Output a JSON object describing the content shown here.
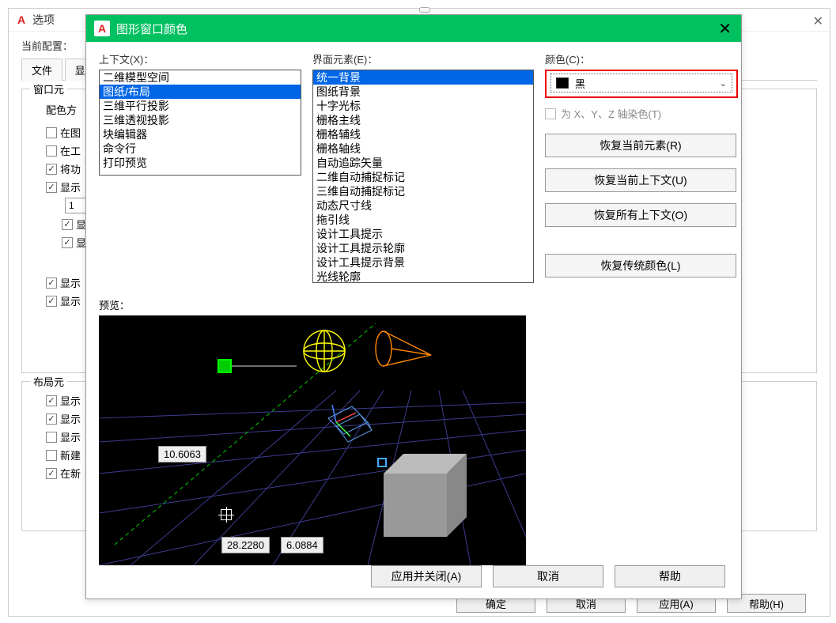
{
  "bg": {
    "title": "选项",
    "config_label": "当前配置：",
    "tabs": [
      "文件",
      "显"
    ],
    "fieldset1_title": "窗口元",
    "color_scheme_label": "配色方",
    "checks": [
      {
        "label": "在图",
        "checked": false
      },
      {
        "label": "在工",
        "checked": false
      },
      {
        "label": "将功",
        "checked": true
      },
      {
        "label": "显示",
        "checked": true
      }
    ],
    "spinner_value": "1",
    "nested_checks": [
      {
        "label": "显示",
        "checked": true
      },
      {
        "label": "显示",
        "checked": true
      }
    ],
    "fieldset2_title": "布局元",
    "checks2": [
      {
        "label": "显示",
        "checked": true
      },
      {
        "label": "显示",
        "checked": true
      },
      {
        "label": "显示",
        "checked": false
      },
      {
        "label": "新建",
        "checked": false
      },
      {
        "label": "在新",
        "checked": true
      }
    ],
    "buttons": [
      "确定",
      "取消",
      "应用(A)",
      "帮助(H)"
    ]
  },
  "fg": {
    "title": "图形窗口颜色",
    "context_label": "上下文(X)：",
    "context_items": [
      "二维模型空间",
      "图纸/布局",
      "三维平行投影",
      "三维透视投影",
      "块编辑器",
      "命令行",
      "打印预览"
    ],
    "context_selected_index": 1,
    "element_label": "界面元素(E)：",
    "element_items": [
      "统一背景",
      "图纸背景",
      "十字光标",
      "栅格主线",
      "栅格辅线",
      "栅格轴线",
      "自动追踪矢量",
      "二维自动捕捉标记",
      "三维自动捕捉标记",
      "动态尺寸线",
      "拖引线",
      "设计工具提示",
      "设计工具提示轮廓",
      "设计工具提示背景",
      "光线轮廓"
    ],
    "element_selected_index": 0,
    "color_label": "颜色(C)：",
    "color_name": "黑",
    "tint_label": "为 X、Y、Z 轴染色(T)",
    "restore_buttons": [
      "恢复当前元素(R)",
      "恢复当前上下文(U)",
      "恢复所有上下文(O)",
      "恢复传统颜色(L)"
    ],
    "preview_label": "预览：",
    "preview_values": {
      "dim1": "10.6063",
      "dim2": "28.2280",
      "dim3": "6.0884"
    },
    "buttons": [
      "应用并关闭(A)",
      "取消",
      "帮助"
    ]
  }
}
